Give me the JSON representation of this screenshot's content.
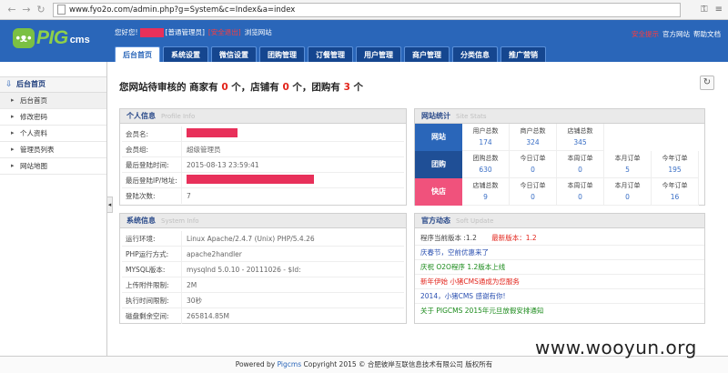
{
  "browser": {
    "url": "www.fyo2o.com/admin.php?g=System&c=Index&a=index"
  },
  "header": {
    "logo_text": "PIG",
    "logo_cms": "cms",
    "welcome": "您好您!",
    "role": "[普通管理员]",
    "logout": "[安全退出]",
    "browse_site": "浏览网站",
    "top_links": [
      "安全提示",
      "官方网站",
      "帮助文档"
    ],
    "nav": [
      {
        "label": "后台首页",
        "active": true
      },
      {
        "label": "系统设置"
      },
      {
        "label": "微信设置"
      },
      {
        "label": "团购管理"
      },
      {
        "label": "订餐管理"
      },
      {
        "label": "用户管理"
      },
      {
        "label": "商户管理"
      },
      {
        "label": "分类信息"
      },
      {
        "label": "推广营销"
      }
    ]
  },
  "sidebar": {
    "title": "后台首页",
    "items": [
      {
        "label": "后台首页",
        "active": true
      },
      {
        "label": "修改密码"
      },
      {
        "label": "个人资料"
      },
      {
        "label": "管理员列表"
      },
      {
        "label": "网站地图"
      }
    ]
  },
  "summary": {
    "prefix": "您网站待审核的 商家有",
    "merchants": "0",
    "mid1": "个，店铺有",
    "stores": "0",
    "mid2": "个，团购有",
    "groups": "3",
    "suffix": "个"
  },
  "personal": {
    "title": "个人信息",
    "subtitle": "Profile Info",
    "rows": [
      {
        "label": "会员名:",
        "value": ""
      },
      {
        "label": "会员组:",
        "value": "超级管理员"
      },
      {
        "label": "最后登陆时间:",
        "value": "2015-08-13 23:59:41"
      },
      {
        "label": "最后登陆IP/地址:",
        "value": ""
      },
      {
        "label": "登陆次数:",
        "value": "7"
      }
    ]
  },
  "site_stats": {
    "title": "网站统计",
    "subtitle": "Site Stats",
    "rows": [
      {
        "label": "网站",
        "color": "#2a66b9",
        "cells": [
          {
            "t": "用户总数",
            "n": "174"
          },
          {
            "t": "商户总数",
            "n": "324"
          },
          {
            "t": "店铺总数",
            "n": "345"
          }
        ]
      },
      {
        "label": "团购",
        "color": "#1f4f96",
        "cells": [
          {
            "t": "团购总数",
            "n": "630"
          },
          {
            "t": "今日订单",
            "n": "0"
          },
          {
            "t": "本周订单",
            "n": "0"
          },
          {
            "t": "本月订单",
            "n": "5"
          },
          {
            "t": "今年订单",
            "n": "195"
          }
        ]
      },
      {
        "label": "快店",
        "color": "#f0527c",
        "cells": [
          {
            "t": "店铺总数",
            "n": "9"
          },
          {
            "t": "今日订单",
            "n": "0"
          },
          {
            "t": "本周订单",
            "n": "0"
          },
          {
            "t": "本月订单",
            "n": "0"
          },
          {
            "t": "今年订单",
            "n": "16"
          }
        ]
      }
    ]
  },
  "system": {
    "title": "系统信息",
    "subtitle": "System Info",
    "rows": [
      {
        "label": "运行环境:",
        "value": "Linux Apache/2.4.7 (Unix) PHP/5.4.26"
      },
      {
        "label": "PHP运行方式:",
        "value": "apache2handler"
      },
      {
        "label": "MYSQL版本:",
        "value": "mysqlnd 5.0.10 - 20111026 - $Id:"
      },
      {
        "label": "上传附件限制:",
        "value": "2M"
      },
      {
        "label": "执行时间限制:",
        "value": "30秒"
      },
      {
        "label": "磁盘剩余空间:",
        "value": "265814.85M"
      }
    ]
  },
  "news": {
    "title": "官方动态",
    "subtitle": "Soft Update",
    "version_label": "程序当前版本 :1.2",
    "latest_label": "最新版本：1.2",
    "items": [
      {
        "text": "庆春节，空前优惠来了",
        "color": "#2a4fb0"
      },
      {
        "text": "庆祝 O2O程序 1.2版本上线",
        "color": "#1a8a1a"
      },
      {
        "text": "新年伊始 小猪CMS通成为您服务",
        "color": "#e2231a"
      },
      {
        "text": "2014，小猪CMS 感谢有你!",
        "color": "#2a4fb0"
      },
      {
        "text": "关于 PIGCMS 2015年元旦放假安排通知",
        "color": "#1a8a1a"
      }
    ]
  },
  "footer": {
    "powered": "Powered by",
    "brand": "Pigcms",
    "rest": "Copyright 2015 © 合肥彼岸互联信息技术有限公司 版权所有"
  },
  "watermark": "www.wooyun.org"
}
